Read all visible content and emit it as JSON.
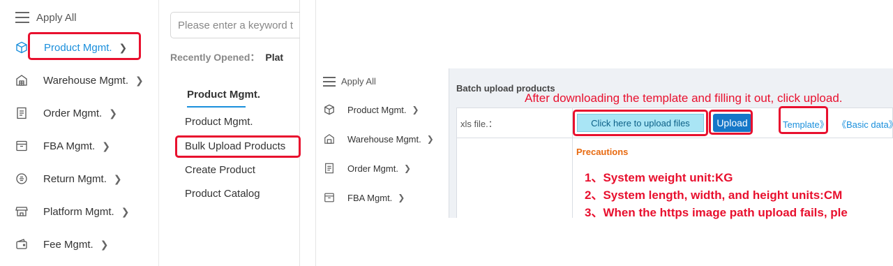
{
  "sidebar": {
    "apply_all": "Apply All",
    "items": [
      {
        "label": "Product Mgmt.",
        "icon": "box-icon"
      },
      {
        "label": "Warehouse Mgmt.",
        "icon": "warehouse-icon"
      },
      {
        "label": "Order Mgmt.",
        "icon": "document-icon"
      },
      {
        "label": "FBA Mgmt.",
        "icon": "inbox-icon"
      },
      {
        "label": "Return Mgmt.",
        "icon": "return-icon"
      },
      {
        "label": "Platform Mgmt.",
        "icon": "shop-icon"
      },
      {
        "label": "Fee Mgmt.",
        "icon": "wallet-icon"
      }
    ]
  },
  "menu_panel": {
    "search_placeholder": "Please enter a keyword t",
    "recent_label": "Recently Opened：",
    "recent_value": "Plat",
    "category_title": "Product Mgmt.",
    "sub_items": [
      "Product Mgmt.",
      "Bulk Upload Products",
      "Create Product",
      "Product Catalog"
    ]
  },
  "small_sidebar": {
    "apply_all": "Apply All",
    "items": [
      "Product Mgmt.",
      "Warehouse Mgmt.",
      "Order Mgmt.",
      "FBA Mgmt."
    ]
  },
  "upload_panel": {
    "title": "Batch upload products",
    "hint": "After downloading the template and filling it out, click upload.",
    "xls_label": "xls file.：",
    "upload_files_label": "Click here to upload files",
    "upload_button": "Upload",
    "template_link": "Template》",
    "basic_data_link": "《Basic data》",
    "precautions_title": "Precautions",
    "precautions": [
      "1、System weight unit:KG",
      "2、System length, width, and height units:CM",
      "3、When the https image path upload fails, ple"
    ]
  },
  "colors": {
    "accent": "#1a8fdc",
    "highlight": "#e8102e",
    "upload_button": "#1677c8"
  }
}
